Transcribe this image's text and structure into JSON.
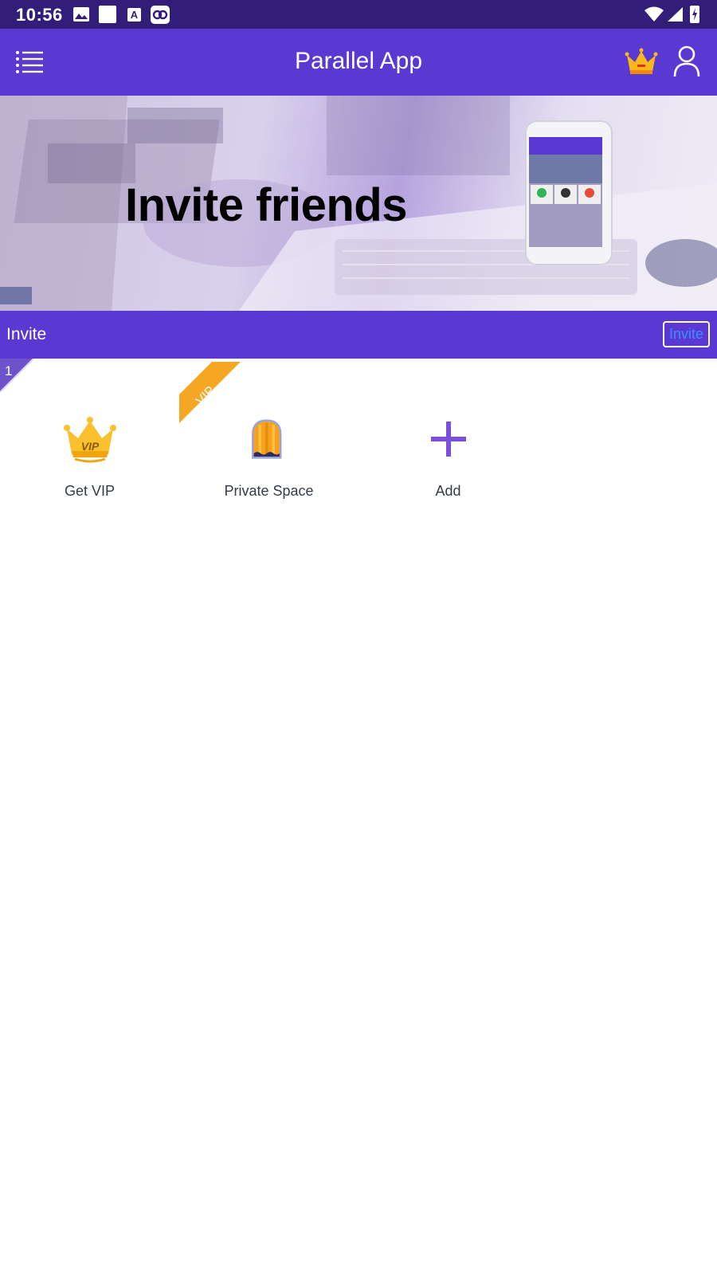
{
  "status_bar": {
    "time": "10:56",
    "a_icon_letter": "A",
    "icons": [
      "gallery-icon",
      "square-icon",
      "font-a-icon",
      "link-icon",
      "wifi-icon",
      "signal-icon",
      "battery-icon"
    ]
  },
  "app_bar": {
    "title": "Parallel App",
    "icons": [
      "menu-list-icon",
      "crown-icon",
      "user-icon"
    ]
  },
  "banner": {
    "title": "Invite friends"
  },
  "invite_bar": {
    "label": "Invite",
    "button_label": "Invite"
  },
  "apps": [
    {
      "label": "Get VIP",
      "icon": "crown-vip-icon",
      "badge": "1"
    },
    {
      "label": "Private Space",
      "icon": "private-space-door-icon",
      "ribbon": "VIP"
    },
    {
      "label": "Add",
      "icon": "plus-icon"
    }
  ],
  "colors": {
    "status_bar": "#321d78",
    "primary": "#5a38d2",
    "invite_button_text": "#3e8dff",
    "ribbon": "#f5a623",
    "accent_purple": "#7b4fdc"
  }
}
